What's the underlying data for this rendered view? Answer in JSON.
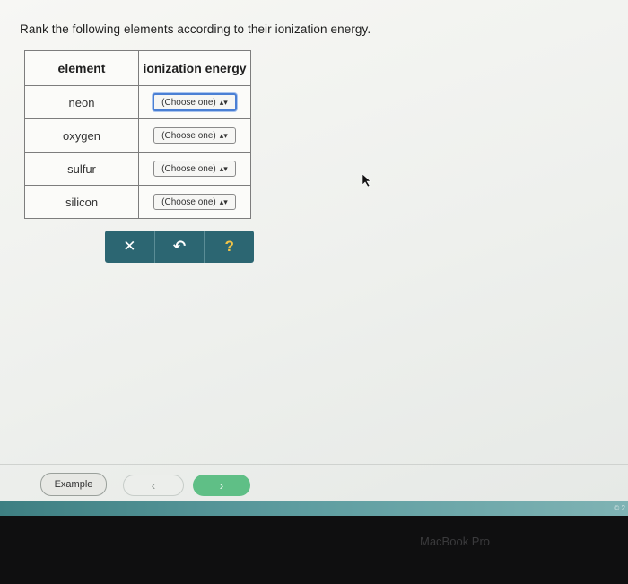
{
  "question": "Rank the following elements according to their ionization energy.",
  "table": {
    "headers": [
      "element",
      "ionization energy"
    ],
    "rows": [
      {
        "element": "neon",
        "selection": "(Choose one)"
      },
      {
        "element": "oxygen",
        "selection": "(Choose one)"
      },
      {
        "element": "sulfur",
        "selection": "(Choose one)"
      },
      {
        "element": "silicon",
        "selection": "(Choose one)"
      }
    ]
  },
  "toolbar": {
    "clear_glyph": "✕",
    "undo_glyph": "↶",
    "help_glyph": "?"
  },
  "footer": {
    "example_label": "Example",
    "prev_glyph": "‹",
    "next_glyph": "›"
  },
  "device": {
    "bezel_label": "MacBook Pro",
    "corner_text": "© 2"
  },
  "colors": {
    "toolbar": "#2c6672",
    "next_button": "#5fbf86",
    "focus_ring": "#4a7fd4",
    "help_icon": "#f3c447"
  },
  "icons": [
    "close-icon",
    "undo-icon",
    "help-icon",
    "chevron-left-icon",
    "chevron-right-icon",
    "mouse-pointer-icon"
  ]
}
